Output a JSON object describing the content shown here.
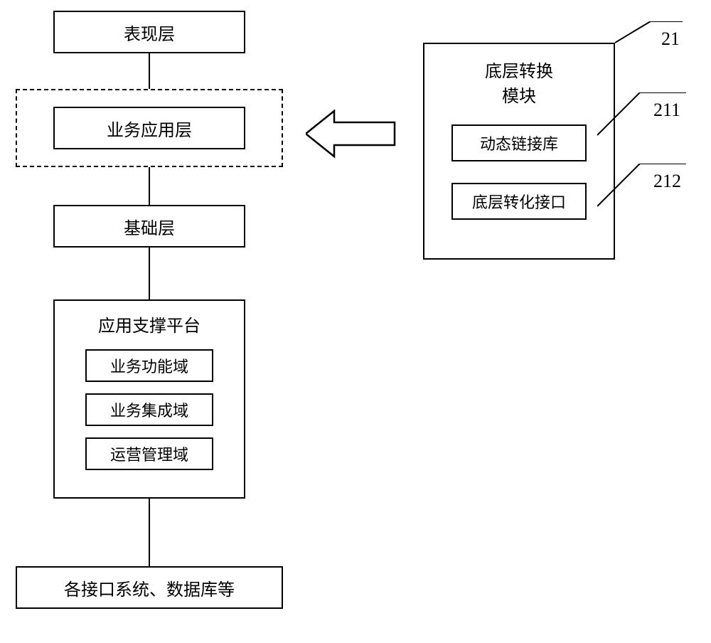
{
  "leftColumn": {
    "presentationLayer": "表现层",
    "businessAppLayer": "业务应用层",
    "foundationLayer": "基础层",
    "appSupportPlatform": {
      "title": "应用支撑平台",
      "businessFunctionDomain": "业务功能域",
      "businessIntegrationDomain": "业务集成域",
      "operationManagementDomain": "运营管理域"
    },
    "interfaceSystems": "各接口系统、数据库等"
  },
  "rightModule": {
    "title": "底层转换\n模块",
    "dynamicLinkLibrary": "动态链接库",
    "conversionInterface": "底层转化接口"
  },
  "labels": {
    "ref21": "21",
    "ref211": "211",
    "ref212": "212"
  },
  "chart_data": {
    "type": "diagram",
    "description": "Architecture diagram showing a layered system with a conversion module",
    "nodes": [
      {
        "id": "presentation",
        "label": "表现层",
        "type": "box"
      },
      {
        "id": "businessApp",
        "label": "业务应用层",
        "type": "dashed-container"
      },
      {
        "id": "foundation",
        "label": "基础层",
        "type": "box"
      },
      {
        "id": "platform",
        "label": "应用支撑平台",
        "type": "container",
        "children": [
          "业务功能域",
          "业务集成域",
          "运营管理域"
        ]
      },
      {
        "id": "interfaces",
        "label": "各接口系统、数据库等",
        "type": "box"
      },
      {
        "id": "convModule",
        "label": "底层转换模块",
        "type": "container",
        "ref": "21",
        "children": [
          {
            "label": "动态链接库",
            "ref": "211"
          },
          {
            "label": "底层转化接口",
            "ref": "212"
          }
        ]
      }
    ],
    "edges": [
      {
        "from": "presentation",
        "to": "businessApp",
        "type": "line"
      },
      {
        "from": "businessApp",
        "to": "foundation",
        "type": "line"
      },
      {
        "from": "foundation",
        "to": "platform",
        "type": "line"
      },
      {
        "from": "platform",
        "to": "interfaces",
        "type": "line"
      },
      {
        "from": "convModule",
        "to": "businessApp",
        "type": "block-arrow"
      }
    ]
  }
}
